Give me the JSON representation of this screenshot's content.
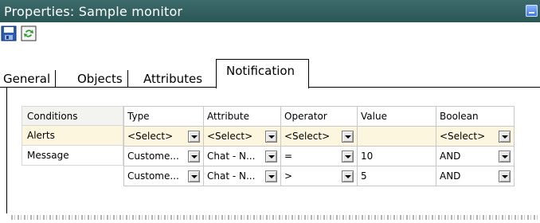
{
  "window": {
    "title": "Properties: Sample monitor"
  },
  "toolbar": {
    "save_icon": "save-icon",
    "refresh_icon": "refresh-icon"
  },
  "tabs": [
    {
      "label": "General"
    },
    {
      "label": "Objects"
    },
    {
      "label": "Attributes"
    },
    {
      "label": "Notification",
      "active": true
    }
  ],
  "left_panel": {
    "header": "Conditions",
    "items": [
      {
        "label": "Alerts",
        "selected": true
      },
      {
        "label": "Message"
      }
    ]
  },
  "grid": {
    "columns": [
      "Type",
      "Attribute",
      "Operator",
      "Value",
      "Boolean"
    ],
    "rows": [
      {
        "type": "<Select>",
        "attribute": "<Select>",
        "operator": "<Select>",
        "value": "",
        "boolean": "<Select>"
      },
      {
        "type": "Custome...",
        "attribute": "Chat - N...",
        "operator": "=",
        "value": "10",
        "boolean": "AND"
      },
      {
        "type": "Custome...",
        "attribute": "Chat - N...",
        "operator": ">",
        "value": "5",
        "boolean": "AND"
      }
    ]
  },
  "colors": {
    "titlebar": "#2f5d5d",
    "selected_row": "#fdf6de",
    "grid_border": "#c8c8c8"
  }
}
